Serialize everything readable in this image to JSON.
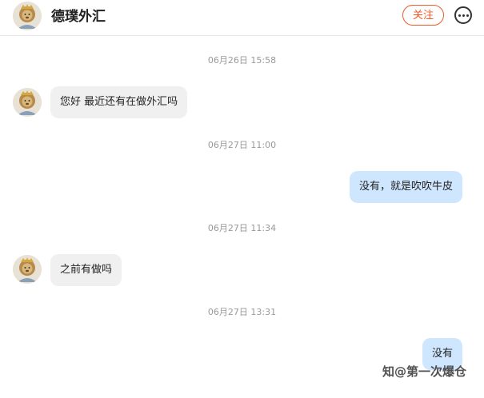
{
  "header": {
    "title": "德璞外汇",
    "follow_label": "关注",
    "more_icon": "more-options-icon"
  },
  "messages": [
    {
      "time": "06月26日 15:58",
      "side": "left",
      "text": "您好 最近还有在做外汇吗"
    },
    {
      "time": "06月27日 11:00",
      "side": "right",
      "text": "没有，就是吹吹牛皮"
    },
    {
      "time": "06月27日 11:34",
      "side": "left",
      "text": "之前有做吗"
    },
    {
      "time": "06月27日 13:31",
      "side": "right",
      "text": "没有"
    }
  ],
  "watermark": "知@第一次爆仓",
  "colors": {
    "accent": "#f05a28",
    "bubble_left": "#f0f0f0",
    "bubble_right": "#cfe6ff",
    "timestamp": "#999999"
  }
}
